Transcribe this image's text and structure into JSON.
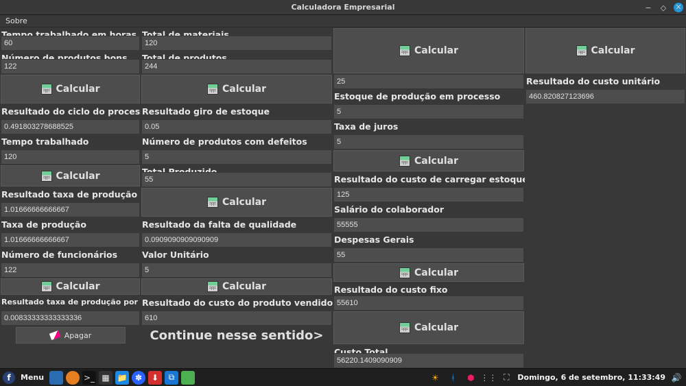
{
  "window": {
    "title": "Calculadora Empresarial",
    "menu_sobre": "Sobre"
  },
  "buttons": {
    "calcular": "Calcular",
    "apagar": "Apagar"
  },
  "continue_text": "Continue nesse sentido>",
  "col1": {
    "lbl_tempo_horas": "Tempo trabalhado em horas",
    "val_tempo_horas": "60",
    "lbl_num_bons": "Número de produtos bons",
    "val_num_bons": "122",
    "lbl_res_ciclo": "Resultado do ciclo do processo",
    "val_res_ciclo": "0.491803278688525",
    "lbl_tempo_trab": "Tempo trabalhado",
    "val_tempo_trab": "120",
    "lbl_res_taxa_prod": "Resultado taxa de produção",
    "val_res_taxa_prod": "1.01666666666667",
    "lbl_taxa_prod": "Taxa de produção",
    "val_taxa_prod": "1.01666666666667",
    "lbl_num_func": "Número de funcionários",
    "val_num_func": "122",
    "lbl_res_taxa_recurso": "Resultado taxa de produção por recurso",
    "val_res_taxa_recurso": "0.00833333333333336"
  },
  "col2": {
    "lbl_total_mat": "Total de materiais",
    "val_total_mat": "120",
    "lbl_total_prod": "Total de produtos",
    "val_total_prod": "244",
    "lbl_res_giro": "Resultado giro de estoque",
    "val_res_giro": "0.05",
    "lbl_num_defeitos": "Número de produtos com defeitos",
    "val_num_defeitos": "5",
    "lbl_total_produzido": "Total Produzido",
    "val_total_produzido": "55",
    "lbl_res_falta_qual": "Resultado da falta de qualidade",
    "val_res_falta_qual": "0.0909090909090909",
    "lbl_valor_unit": "Valor Unitário",
    "val_valor_unit": "5",
    "lbl_res_custo_vendido": "Resultado do custo do produto vendido",
    "val_res_custo_vendido": "610"
  },
  "col3": {
    "val_top": "25",
    "lbl_estoque_proc": "Estoque de produção em processo",
    "val_estoque_proc": "5",
    "lbl_taxa_juros": "Taxa de juros",
    "val_taxa_juros": "5",
    "lbl_res_custo_carregar": "Resultado do custo de carregar estoque",
    "val_res_custo_carregar": "125",
    "lbl_salario": "Salário do colaborador",
    "val_salario": "55555",
    "lbl_despesas": "Despesas Gerais",
    "val_despesas": "55",
    "lbl_res_custo_fixo": "Resultado do custo fixo",
    "val_res_custo_fixo": "55610",
    "lbl_custo_total": "Custo Total",
    "val_custo_total": "56220.1409090909"
  },
  "col4": {
    "lbl_res_custo_unit": "Resultado do custo unitário",
    "val_res_custo_unit": "460.820827123696"
  },
  "taskbar": {
    "menu": "Menu",
    "clock": "Domingo,  6 de setembro, 11:33:49"
  }
}
